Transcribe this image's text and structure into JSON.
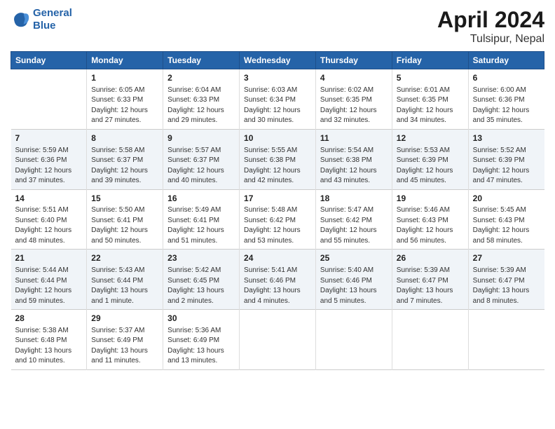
{
  "header": {
    "logo_line1": "General",
    "logo_line2": "Blue",
    "title": "April 2024",
    "subtitle": "Tulsipur, Nepal"
  },
  "columns": [
    "Sunday",
    "Monday",
    "Tuesday",
    "Wednesday",
    "Thursday",
    "Friday",
    "Saturday"
  ],
  "weeks": [
    [
      {
        "num": "",
        "info": ""
      },
      {
        "num": "1",
        "info": "Sunrise: 6:05 AM\nSunset: 6:33 PM\nDaylight: 12 hours\nand 27 minutes."
      },
      {
        "num": "2",
        "info": "Sunrise: 6:04 AM\nSunset: 6:33 PM\nDaylight: 12 hours\nand 29 minutes."
      },
      {
        "num": "3",
        "info": "Sunrise: 6:03 AM\nSunset: 6:34 PM\nDaylight: 12 hours\nand 30 minutes."
      },
      {
        "num": "4",
        "info": "Sunrise: 6:02 AM\nSunset: 6:35 PM\nDaylight: 12 hours\nand 32 minutes."
      },
      {
        "num": "5",
        "info": "Sunrise: 6:01 AM\nSunset: 6:35 PM\nDaylight: 12 hours\nand 34 minutes."
      },
      {
        "num": "6",
        "info": "Sunrise: 6:00 AM\nSunset: 6:36 PM\nDaylight: 12 hours\nand 35 minutes."
      }
    ],
    [
      {
        "num": "7",
        "info": "Sunrise: 5:59 AM\nSunset: 6:36 PM\nDaylight: 12 hours\nand 37 minutes."
      },
      {
        "num": "8",
        "info": "Sunrise: 5:58 AM\nSunset: 6:37 PM\nDaylight: 12 hours\nand 39 minutes."
      },
      {
        "num": "9",
        "info": "Sunrise: 5:57 AM\nSunset: 6:37 PM\nDaylight: 12 hours\nand 40 minutes."
      },
      {
        "num": "10",
        "info": "Sunrise: 5:55 AM\nSunset: 6:38 PM\nDaylight: 12 hours\nand 42 minutes."
      },
      {
        "num": "11",
        "info": "Sunrise: 5:54 AM\nSunset: 6:38 PM\nDaylight: 12 hours\nand 43 minutes."
      },
      {
        "num": "12",
        "info": "Sunrise: 5:53 AM\nSunset: 6:39 PM\nDaylight: 12 hours\nand 45 minutes."
      },
      {
        "num": "13",
        "info": "Sunrise: 5:52 AM\nSunset: 6:39 PM\nDaylight: 12 hours\nand 47 minutes."
      }
    ],
    [
      {
        "num": "14",
        "info": "Sunrise: 5:51 AM\nSunset: 6:40 PM\nDaylight: 12 hours\nand 48 minutes."
      },
      {
        "num": "15",
        "info": "Sunrise: 5:50 AM\nSunset: 6:41 PM\nDaylight: 12 hours\nand 50 minutes."
      },
      {
        "num": "16",
        "info": "Sunrise: 5:49 AM\nSunset: 6:41 PM\nDaylight: 12 hours\nand 51 minutes."
      },
      {
        "num": "17",
        "info": "Sunrise: 5:48 AM\nSunset: 6:42 PM\nDaylight: 12 hours\nand 53 minutes."
      },
      {
        "num": "18",
        "info": "Sunrise: 5:47 AM\nSunset: 6:42 PM\nDaylight: 12 hours\nand 55 minutes."
      },
      {
        "num": "19",
        "info": "Sunrise: 5:46 AM\nSunset: 6:43 PM\nDaylight: 12 hours\nand 56 minutes."
      },
      {
        "num": "20",
        "info": "Sunrise: 5:45 AM\nSunset: 6:43 PM\nDaylight: 12 hours\nand 58 minutes."
      }
    ],
    [
      {
        "num": "21",
        "info": "Sunrise: 5:44 AM\nSunset: 6:44 PM\nDaylight: 12 hours\nand 59 minutes."
      },
      {
        "num": "22",
        "info": "Sunrise: 5:43 AM\nSunset: 6:44 PM\nDaylight: 13 hours\nand 1 minute."
      },
      {
        "num": "23",
        "info": "Sunrise: 5:42 AM\nSunset: 6:45 PM\nDaylight: 13 hours\nand 2 minutes."
      },
      {
        "num": "24",
        "info": "Sunrise: 5:41 AM\nSunset: 6:46 PM\nDaylight: 13 hours\nand 4 minutes."
      },
      {
        "num": "25",
        "info": "Sunrise: 5:40 AM\nSunset: 6:46 PM\nDaylight: 13 hours\nand 5 minutes."
      },
      {
        "num": "26",
        "info": "Sunrise: 5:39 AM\nSunset: 6:47 PM\nDaylight: 13 hours\nand 7 minutes."
      },
      {
        "num": "27",
        "info": "Sunrise: 5:39 AM\nSunset: 6:47 PM\nDaylight: 13 hours\nand 8 minutes."
      }
    ],
    [
      {
        "num": "28",
        "info": "Sunrise: 5:38 AM\nSunset: 6:48 PM\nDaylight: 13 hours\nand 10 minutes."
      },
      {
        "num": "29",
        "info": "Sunrise: 5:37 AM\nSunset: 6:49 PM\nDaylight: 13 hours\nand 11 minutes."
      },
      {
        "num": "30",
        "info": "Sunrise: 5:36 AM\nSunset: 6:49 PM\nDaylight: 13 hours\nand 13 minutes."
      },
      {
        "num": "",
        "info": ""
      },
      {
        "num": "",
        "info": ""
      },
      {
        "num": "",
        "info": ""
      },
      {
        "num": "",
        "info": ""
      }
    ]
  ]
}
